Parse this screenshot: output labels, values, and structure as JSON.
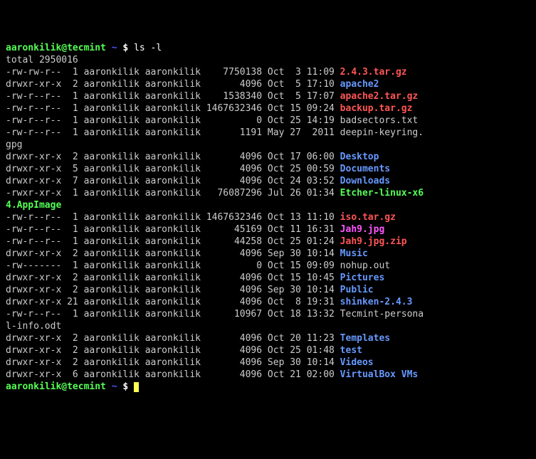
{
  "prompt": {
    "user": "aaronkilik@tecmint",
    "path": "~",
    "dollar": "$"
  },
  "command": "ls -l",
  "total_line": "total 2950016",
  "rows": [
    {
      "perm": "-rw-rw-r--",
      "links": " 1",
      "owner": "aaronkilik",
      "group": "aaronkilik",
      "size": "   7750138",
      "date": "Oct  3 11:09",
      "name": "2.4.3.tar.gz",
      "cls": "arch"
    },
    {
      "perm": "drwxr-xr-x",
      "links": " 2",
      "owner": "aaronkilik",
      "group": "aaronkilik",
      "size": "      4096",
      "date": "Oct  5 17:10",
      "name": "apache2",
      "cls": "dir"
    },
    {
      "perm": "-rw-r--r--",
      "links": " 1",
      "owner": "aaronkilik",
      "group": "aaronkilik",
      "size": "   1538340",
      "date": "Oct  5 17:07",
      "name": "apache2.tar.gz",
      "cls": "arch"
    },
    {
      "perm": "-rw-r--r--",
      "links": " 1",
      "owner": "aaronkilik",
      "group": "aaronkilik",
      "size": "1467632346",
      "date": "Oct 15 09:24",
      "name": "backup.tar.gz",
      "cls": "arch"
    },
    {
      "perm": "-rw-r--r--",
      "links": " 1",
      "owner": "aaronkilik",
      "group": "aaronkilik",
      "size": "         0",
      "date": "Oct 25 14:19",
      "name": "badsectors.txt",
      "cls": "plain"
    },
    {
      "perm": "-rw-r--r--",
      "links": " 1",
      "owner": "aaronkilik",
      "group": "aaronkilik",
      "size": "      1191",
      "date": "May 27  2011",
      "name": "deepin-keyring.",
      "cls": "plain",
      "wrap": "gpg"
    },
    {
      "perm": "drwxr-xr-x",
      "links": " 2",
      "owner": "aaronkilik",
      "group": "aaronkilik",
      "size": "      4096",
      "date": "Oct 17 06:00",
      "name": "Desktop",
      "cls": "dir"
    },
    {
      "perm": "drwxr-xr-x",
      "links": " 5",
      "owner": "aaronkilik",
      "group": "aaronkilik",
      "size": "      4096",
      "date": "Oct 25 00:59",
      "name": "Documents",
      "cls": "dir"
    },
    {
      "perm": "drwxr-xr-x",
      "links": " 7",
      "owner": "aaronkilik",
      "group": "aaronkilik",
      "size": "      4096",
      "date": "Oct 24 03:52",
      "name": "Downloads",
      "cls": "dir"
    },
    {
      "perm": "-rwxr-xr-x",
      "links": " 1",
      "owner": "aaronkilik",
      "group": "aaronkilik",
      "size": "  76087296",
      "date": "Jul 26 01:34",
      "name": "Etcher-linux-x6",
      "cls": "exec",
      "wrap": "4.AppImage",
      "wrapcls": "exec"
    },
    {
      "perm": "-rw-r--r--",
      "links": " 1",
      "owner": "aaronkilik",
      "group": "aaronkilik",
      "size": "1467632346",
      "date": "Oct 13 11:10",
      "name": "iso.tar.gz",
      "cls": "arch"
    },
    {
      "perm": "-rw-r--r--",
      "links": " 1",
      "owner": "aaronkilik",
      "group": "aaronkilik",
      "size": "     45169",
      "date": "Oct 11 16:31",
      "name": "Jah9.jpg",
      "cls": "img"
    },
    {
      "perm": "-rw-r--r--",
      "links": " 1",
      "owner": "aaronkilik",
      "group": "aaronkilik",
      "size": "     44258",
      "date": "Oct 25 01:24",
      "name": "Jah9.jpg.zip",
      "cls": "arch"
    },
    {
      "perm": "drwxr-xr-x",
      "links": " 2",
      "owner": "aaronkilik",
      "group": "aaronkilik",
      "size": "      4096",
      "date": "Sep 30 10:14",
      "name": "Music",
      "cls": "dir"
    },
    {
      "perm": "-rw-------",
      "links": " 1",
      "owner": "aaronkilik",
      "group": "aaronkilik",
      "size": "         0",
      "date": "Oct 15 09:09",
      "name": "nohup.out",
      "cls": "plain"
    },
    {
      "perm": "drwxr-xr-x",
      "links": " 2",
      "owner": "aaronkilik",
      "group": "aaronkilik",
      "size": "      4096",
      "date": "Oct 15 10:45",
      "name": "Pictures",
      "cls": "dir"
    },
    {
      "perm": "drwxr-xr-x",
      "links": " 2",
      "owner": "aaronkilik",
      "group": "aaronkilik",
      "size": "      4096",
      "date": "Sep 30 10:14",
      "name": "Public",
      "cls": "dir"
    },
    {
      "perm": "drwxr-xr-x",
      "links": "21",
      "owner": "aaronkilik",
      "group": "aaronkilik",
      "size": "      4096",
      "date": "Oct  8 19:31",
      "name": "shinken-2.4.3",
      "cls": "dir"
    },
    {
      "perm": "-rw-r--r--",
      "links": " 1",
      "owner": "aaronkilik",
      "group": "aaronkilik",
      "size": "     10967",
      "date": "Oct 18 13:32",
      "name": "Tecmint-persona",
      "cls": "plain",
      "wrap": "l-info.odt"
    },
    {
      "perm": "drwxr-xr-x",
      "links": " 2",
      "owner": "aaronkilik",
      "group": "aaronkilik",
      "size": "      4096",
      "date": "Oct 20 11:23",
      "name": "Templates",
      "cls": "dir"
    },
    {
      "perm": "drwxr-xr-x",
      "links": " 2",
      "owner": "aaronkilik",
      "group": "aaronkilik",
      "size": "      4096",
      "date": "Oct 25 01:48",
      "name": "test",
      "cls": "dir"
    },
    {
      "perm": "drwxr-xr-x",
      "links": " 2",
      "owner": "aaronkilik",
      "group": "aaronkilik",
      "size": "      4096",
      "date": "Sep 30 10:14",
      "name": "Videos",
      "cls": "dir"
    },
    {
      "perm": "drwxr-xr-x",
      "links": " 6",
      "owner": "aaronkilik",
      "group": "aaronkilik",
      "size": "      4096",
      "date": "Oct 21 02:00",
      "name": "VirtualBox VMs",
      "cls": "dir"
    }
  ]
}
